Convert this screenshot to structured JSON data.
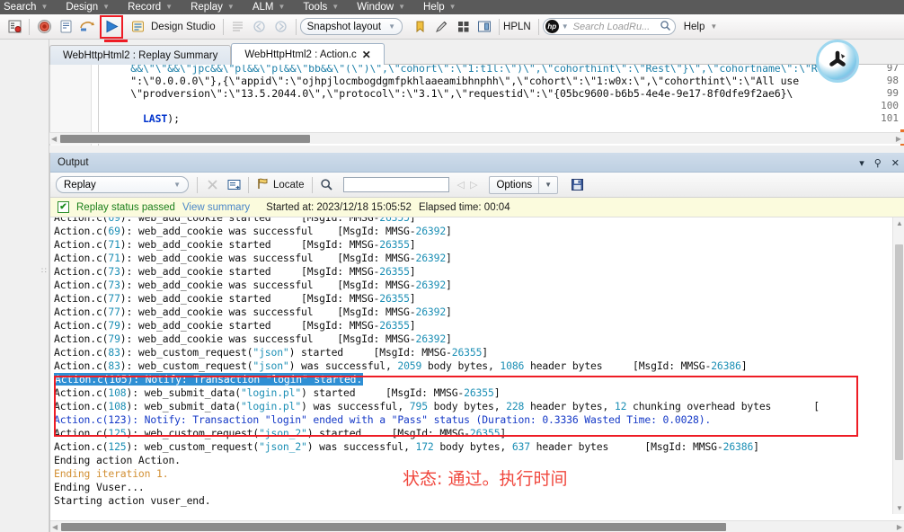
{
  "menubar": {
    "items": [
      {
        "label": "Search",
        "caret": "▼"
      },
      {
        "label": "Design",
        "caret": "▼"
      },
      {
        "label": "Record",
        "caret": "▼"
      },
      {
        "label": "Replay",
        "caret": "▼"
      },
      {
        "label": "ALM",
        "caret": "▼"
      },
      {
        "label": "Tools",
        "caret": "▼"
      },
      {
        "label": "Window",
        "caret": "▼"
      },
      {
        "label": "Help",
        "caret": "▼"
      }
    ]
  },
  "toolbar": {
    "design_studio_label": "Design Studio",
    "snapshot_layout_label": "Snapshot layout",
    "hpln_label": "HPLN",
    "search_placeholder": "Search LoadRu...",
    "help_label": "Help",
    "hp_badge": "hp",
    "caret": "▼",
    "icons": {
      "record_options": "record-options-icon",
      "record": "record-icon",
      "compile": "compile-icon",
      "replay_arrow": "replay-arrow-icon",
      "run_play": "run-play-icon",
      "design_studio": "design-studio-icon",
      "list": "list-icon",
      "step_back": "step-back-icon",
      "step_forward": "step-forward-icon",
      "bookmark": "bookmark-icon",
      "pencil": "pencil-icon",
      "grid": "grid-icon",
      "panel": "panel-icon",
      "magnifier": "magnifier-icon"
    }
  },
  "tabs": {
    "close_all": "✕",
    "items": [
      {
        "label": "WebHttpHtml2 : Replay Summary",
        "active": false,
        "closable": false
      },
      {
        "label": "WebHttpHtml2 : Action.c",
        "active": true,
        "closable": true,
        "close": "✕"
      }
    ]
  },
  "editor": {
    "lines": [
      {
        "num": "97",
        "text": "    &&\\\"\\\"&&\\\"jpc&&\\\"pl&&\\\"pl&&\\\"bb&&\\\"(\\\")\\\",\\\"cohort\\\":\\\"1:t1l:\\\")\\\",\\\"cohorthint\\\":\\\"Rest\\\"}\\\",\\\"cohortname\\\":\\\"Rest\\\"}"
      },
      {
        "num": "98",
        "text": "    \":\\\"0.0.0.0\\\"},{\\\"appid\\\":\\\"ojhpjlocmbogdgmfpkhlaaeamibhnphh\\\",\\\"cohort\\\":\\\"1:w0x:\\\",\\\"cohorthint\\\":\\\"All use"
      },
      {
        "num": "99",
        "text": "    \\\"prodversion\\\":\\\"13.5.2044.0\\\",\\\"protocol\\\":\\\"3.1\\\",\\\"requestid\\\":\\\"{05bc9600-b6b5-4e4e-9e17-8f0dfe9f2ae6}\\"
      },
      {
        "num": "100",
        "text": "    LAST);"
      },
      {
        "num": "101",
        "text": ""
      }
    ],
    "last_keyword": "LAST",
    "last_tail": ");"
  },
  "output": {
    "title": "Output",
    "title_buttons": [
      {
        "name": "dropdown",
        "glyph": "▾"
      },
      {
        "name": "pin",
        "glyph": "⚲"
      },
      {
        "name": "close",
        "glyph": "✕"
      }
    ],
    "toolbar": {
      "source_value": "Replay",
      "caret": "▼",
      "clear_label": "✕",
      "copy_label": "copy-icon",
      "locate_label": "Locate",
      "find_placeholder": "",
      "find_value": "",
      "prev_label": "◁",
      "next_label": "▷",
      "options_label": "Options",
      "options_caret": "▼",
      "save_label": "save-icon"
    },
    "status": {
      "icon": "✔",
      "passed_text": "Replay status passed",
      "view_summary": "View summary",
      "started_at": "Started at: 2023/12/18 15:05:52",
      "elapsed": "Elapsed time: 00:04"
    },
    "log_lines": [
      {
        "id": "l0",
        "clipped": true,
        "parts": [
          {
            "t": "Action.c(",
            "c": "plain"
          },
          {
            "t": "69",
            "c": "n"
          },
          {
            "t": "): web_add_cookie started     [MsgId: MMSG-",
            "c": "plain"
          },
          {
            "t": "26355",
            "c": "n"
          },
          {
            "t": "]",
            "c": "plain"
          }
        ]
      },
      {
        "id": "l1",
        "parts": [
          {
            "t": "Action.c(",
            "c": "plain"
          },
          {
            "t": "69",
            "c": "n"
          },
          {
            "t": "): web_add_cookie was successful    [MsgId: MMSG-",
            "c": "plain"
          },
          {
            "t": "26392",
            "c": "n"
          },
          {
            "t": "]",
            "c": "plain"
          }
        ]
      },
      {
        "id": "l2",
        "parts": [
          {
            "t": "Action.c(",
            "c": "plain"
          },
          {
            "t": "71",
            "c": "n"
          },
          {
            "t": "): web_add_cookie started     [MsgId: MMSG-",
            "c": "plain"
          },
          {
            "t": "26355",
            "c": "n"
          },
          {
            "t": "]",
            "c": "plain"
          }
        ]
      },
      {
        "id": "l3",
        "parts": [
          {
            "t": "Action.c(",
            "c": "plain"
          },
          {
            "t": "71",
            "c": "n"
          },
          {
            "t": "): web_add_cookie was successful    [MsgId: MMSG-",
            "c": "plain"
          },
          {
            "t": "26392",
            "c": "n"
          },
          {
            "t": "]",
            "c": "plain"
          }
        ]
      },
      {
        "id": "l4",
        "parts": [
          {
            "t": "Action.c(",
            "c": "plain"
          },
          {
            "t": "73",
            "c": "n"
          },
          {
            "t": "): web_add_cookie started     [MsgId: MMSG-",
            "c": "plain"
          },
          {
            "t": "26355",
            "c": "n"
          },
          {
            "t": "]",
            "c": "plain"
          }
        ]
      },
      {
        "id": "l5",
        "parts": [
          {
            "t": "Action.c(",
            "c": "plain"
          },
          {
            "t": "73",
            "c": "n"
          },
          {
            "t": "): web_add_cookie was successful    [MsgId: MMSG-",
            "c": "plain"
          },
          {
            "t": "26392",
            "c": "n"
          },
          {
            "t": "]",
            "c": "plain"
          }
        ]
      },
      {
        "id": "l6",
        "parts": [
          {
            "t": "Action.c(",
            "c": "plain"
          },
          {
            "t": "77",
            "c": "n"
          },
          {
            "t": "): web_add_cookie started     [MsgId: MMSG-",
            "c": "plain"
          },
          {
            "t": "26355",
            "c": "n"
          },
          {
            "t": "]",
            "c": "plain"
          }
        ]
      },
      {
        "id": "l7",
        "parts": [
          {
            "t": "Action.c(",
            "c": "plain"
          },
          {
            "t": "77",
            "c": "n"
          },
          {
            "t": "): web_add_cookie was successful    [MsgId: MMSG-",
            "c": "plain"
          },
          {
            "t": "26392",
            "c": "n"
          },
          {
            "t": "]",
            "c": "plain"
          }
        ]
      },
      {
        "id": "l8",
        "parts": [
          {
            "t": "Action.c(",
            "c": "plain"
          },
          {
            "t": "79",
            "c": "n"
          },
          {
            "t": "): web_add_cookie started     [MsgId: MMSG-",
            "c": "plain"
          },
          {
            "t": "26355",
            "c": "n"
          },
          {
            "t": "]",
            "c": "plain"
          }
        ]
      },
      {
        "id": "l9",
        "parts": [
          {
            "t": "Action.c(",
            "c": "plain"
          },
          {
            "t": "79",
            "c": "n"
          },
          {
            "t": "): web_add_cookie was successful    [MsgId: MMSG-",
            "c": "plain"
          },
          {
            "t": "26392",
            "c": "n"
          },
          {
            "t": "]",
            "c": "plain"
          }
        ]
      },
      {
        "id": "l10",
        "parts": [
          {
            "t": "Action.c(",
            "c": "plain"
          },
          {
            "t": "83",
            "c": "n"
          },
          {
            "t": "): web_custom_request(",
            "c": "plain"
          },
          {
            "t": "\"json\"",
            "c": "s"
          },
          {
            "t": ") started     [MsgId: MMSG-",
            "c": "plain"
          },
          {
            "t": "26355",
            "c": "n"
          },
          {
            "t": "]",
            "c": "plain"
          }
        ]
      },
      {
        "id": "l11",
        "clipped_bottom": true,
        "parts": [
          {
            "t": "Action.c(",
            "c": "plain"
          },
          {
            "t": "83",
            "c": "n"
          },
          {
            "t": "): web_custom_request(",
            "c": "plain"
          },
          {
            "t": "\"json\"",
            "c": "s"
          },
          {
            "t": ") was successful, ",
            "c": "plain"
          },
          {
            "t": "2059",
            "c": "n"
          },
          {
            "t": " body bytes, ",
            "c": "plain"
          },
          {
            "t": "1086",
            "c": "n"
          },
          {
            "t": " header bytes     [MsgId: MMSG-",
            "c": "plain"
          },
          {
            "t": "26386",
            "c": "n"
          },
          {
            "t": "]",
            "c": "plain"
          }
        ]
      },
      {
        "id": "l12",
        "selected": true,
        "parts": [
          {
            "t": "Action.c(105): Notify: Transaction \"login\" started.",
            "c": "plain"
          }
        ]
      },
      {
        "id": "l13",
        "parts": [
          {
            "t": "Action.c(",
            "c": "plain"
          },
          {
            "t": "108",
            "c": "n"
          },
          {
            "t": "): web_submit_data(",
            "c": "plain"
          },
          {
            "t": "\"login.pl\"",
            "c": "s"
          },
          {
            "t": ") started     [MsgId: MMSG-",
            "c": "plain"
          },
          {
            "t": "26355",
            "c": "n"
          },
          {
            "t": "]",
            "c": "plain"
          }
        ]
      },
      {
        "id": "l14",
        "parts": [
          {
            "t": "Action.c(",
            "c": "plain"
          },
          {
            "t": "108",
            "c": "n"
          },
          {
            "t": "): web_submit_data(",
            "c": "plain"
          },
          {
            "t": "\"login.pl\"",
            "c": "s"
          },
          {
            "t": ") was successful, ",
            "c": "plain"
          },
          {
            "t": "795",
            "c": "n"
          },
          {
            "t": " body bytes, ",
            "c": "plain"
          },
          {
            "t": "228",
            "c": "n"
          },
          {
            "t": " header bytes, ",
            "c": "plain"
          },
          {
            "t": "12",
            "c": "n"
          },
          {
            "t": " chunking overhead bytes       [",
            "c": "plain"
          }
        ]
      },
      {
        "id": "l15",
        "blue": true,
        "parts": [
          {
            "t": "Action.c(123): Notify: Transaction \"login\" ended with a \"Pass\" status (Duration: 0.3336 Wasted Time: 0.0028).",
            "c": "blue"
          }
        ]
      },
      {
        "id": "l16",
        "clipped_top": true,
        "parts": [
          {
            "t": "Action.c(",
            "c": "plain"
          },
          {
            "t": "125",
            "c": "n"
          },
          {
            "t": "): web_custom_request(",
            "c": "plain"
          },
          {
            "t": "\"json_2\"",
            "c": "s"
          },
          {
            "t": ") started     [MsgId: MMSG-",
            "c": "plain"
          },
          {
            "t": "26355",
            "c": "n"
          },
          {
            "t": "]",
            "c": "plain"
          }
        ]
      },
      {
        "id": "l17",
        "parts": [
          {
            "t": "Action.c(",
            "c": "plain"
          },
          {
            "t": "125",
            "c": "n"
          },
          {
            "t": "): web_custom_request(",
            "c": "plain"
          },
          {
            "t": "\"json_2\"",
            "c": "s"
          },
          {
            "t": ") was successful, ",
            "c": "plain"
          },
          {
            "t": "172",
            "c": "n"
          },
          {
            "t": " body bytes, ",
            "c": "plain"
          },
          {
            "t": "637",
            "c": "n"
          },
          {
            "t": " header bytes      [MsgId: MMSG-",
            "c": "plain"
          },
          {
            "t": "26386",
            "c": "n"
          },
          {
            "t": "]",
            "c": "plain"
          }
        ]
      },
      {
        "id": "l18",
        "parts": [
          {
            "t": "Ending action Action.",
            "c": "plain"
          }
        ]
      },
      {
        "id": "l19",
        "parts": [
          {
            "t": "Ending iteration 1.",
            "c": "orange"
          }
        ]
      },
      {
        "id": "l20",
        "parts": [
          {
            "t": "Ending Vuser...",
            "c": "plain"
          }
        ]
      },
      {
        "id": "l21",
        "parts": [
          {
            "t": "Starting action vuser_end.",
            "c": "plain"
          }
        ]
      }
    ]
  },
  "annotations": {
    "chinese_note": "状态: 通过。执行时间",
    "highlight_color": "#ee1c25",
    "selection_color": "#2e8fd4"
  }
}
